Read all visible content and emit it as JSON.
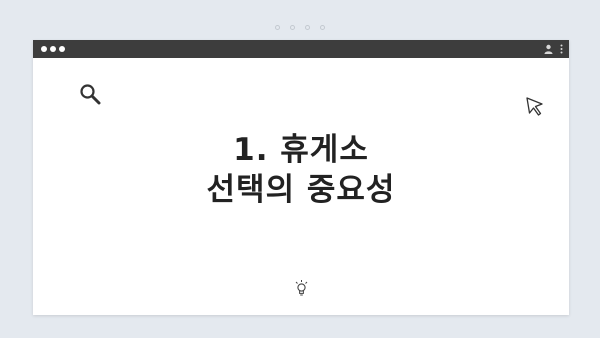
{
  "window": {
    "title_line_1": "1. 휴게소",
    "title_line_2": "선택의 중요성"
  },
  "icons": {
    "search": "search-icon",
    "cursor": "cursor-icon",
    "lightbulb": "lightbulb-icon",
    "user": "user-icon",
    "menu": "kebab-menu-icon"
  },
  "colors": {
    "background": "#e4e9ef",
    "titlebar": "#3d3d3d",
    "window": "#ffffff",
    "text": "#222222"
  }
}
